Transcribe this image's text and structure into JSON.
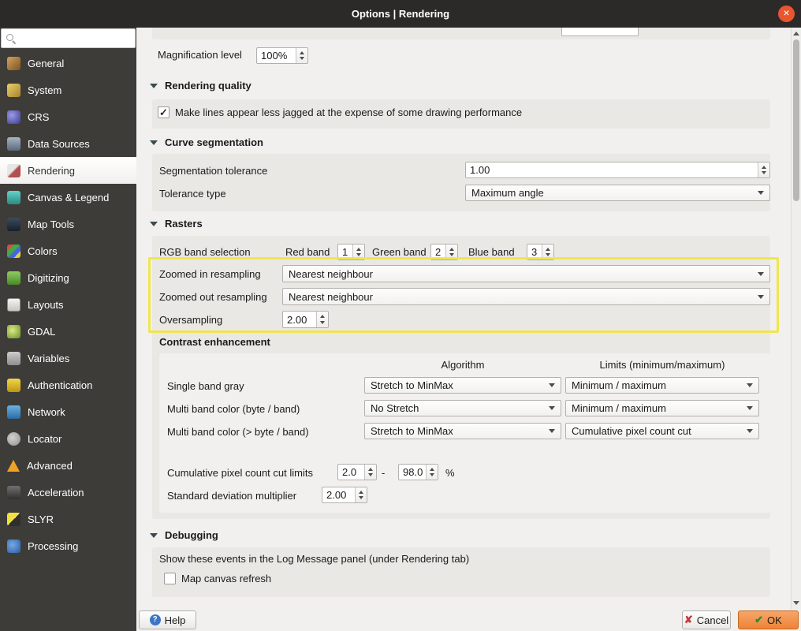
{
  "window": {
    "title": "Options | Rendering",
    "close_glyph": "×"
  },
  "sidebar": {
    "items": [
      {
        "label": "General",
        "icon": "general-icon"
      },
      {
        "label": "System",
        "icon": "system-icon"
      },
      {
        "label": "CRS",
        "icon": "crs-icon"
      },
      {
        "label": "Data Sources",
        "icon": "data-sources-icon"
      },
      {
        "label": "Rendering",
        "icon": "rendering-icon",
        "selected": true
      },
      {
        "label": "Canvas & Legend",
        "icon": "canvas-legend-icon"
      },
      {
        "label": "Map Tools",
        "icon": "map-tools-icon"
      },
      {
        "label": "Colors",
        "icon": "colors-icon"
      },
      {
        "label": "Digitizing",
        "icon": "digitizing-icon"
      },
      {
        "label": "Layouts",
        "icon": "layouts-icon"
      },
      {
        "label": "GDAL",
        "icon": "gdal-icon"
      },
      {
        "label": "Variables",
        "icon": "variables-icon"
      },
      {
        "label": "Authentication",
        "icon": "authentication-icon"
      },
      {
        "label": "Network",
        "icon": "network-icon"
      },
      {
        "label": "Locator",
        "icon": "locator-icon"
      },
      {
        "label": "Advanced",
        "icon": "advanced-icon"
      },
      {
        "label": "Acceleration",
        "icon": "acceleration-icon"
      },
      {
        "label": "SLYR",
        "icon": "slyr-icon"
      },
      {
        "label": "Processing",
        "icon": "processing-icon"
      }
    ]
  },
  "content": {
    "magnification_label": "Magnification level",
    "magnification_value": "100%",
    "check_glyph": "✓",
    "rendering_quality": {
      "title": "Rendering quality",
      "antialias_label": "Make lines appear less jagged at the expense of some drawing performance",
      "antialias_checked": true
    },
    "curve_segmentation": {
      "title": "Curve segmentation",
      "tolerance_label": "Segmentation tolerance",
      "tolerance_value": "1.00",
      "type_label": "Tolerance type",
      "type_value": "Maximum angle"
    },
    "rasters": {
      "title": "Rasters",
      "rgb_label": "RGB band selection",
      "red_label": "Red band",
      "red_value": "1",
      "green_label": "Green band",
      "green_value": "2",
      "blue_label": "Blue band",
      "blue_value": "3",
      "zoomed_in_label": "Zoomed in resampling",
      "zoomed_in_value": "Nearest neighbour",
      "zoomed_out_label": "Zoomed out resampling",
      "zoomed_out_value": "Nearest neighbour",
      "oversampling_label": "Oversampling",
      "oversampling_value": "2.00"
    },
    "contrast": {
      "title": "Contrast enhancement",
      "algorithm_header": "Algorithm",
      "limits_header": "Limits (minimum/maximum)",
      "rows": [
        {
          "label": "Single band gray",
          "algorithm": "Stretch to MinMax",
          "limits": "Minimum / maximum"
        },
        {
          "label": "Multi band color (byte / band)",
          "algorithm": "No Stretch",
          "limits": "Minimum / maximum"
        },
        {
          "label": "Multi band color (> byte / band)",
          "algorithm": "Stretch to MinMax",
          "limits": "Cumulative pixel count cut"
        }
      ],
      "cumulative_label": "Cumulative pixel count cut limits",
      "cumulative_min": "2.0",
      "cumulative_sep": "-",
      "cumulative_max": "98.0",
      "cumulative_unit": "%",
      "stddev_label": "Standard deviation multiplier",
      "stddev_value": "2.00"
    },
    "debugging": {
      "title": "Debugging",
      "description": "Show these events in the Log Message panel (under Rendering tab)",
      "map_canvas_refresh_label": "Map canvas refresh",
      "map_canvas_refresh_checked": false
    }
  },
  "footer": {
    "help_label": "Help",
    "help_icon_glyph": "?",
    "cancel_label": "Cancel",
    "cancel_icon_glyph": "✘",
    "ok_label": "OK",
    "ok_icon_glyph": "✔"
  },
  "colors": {
    "accent_orange": "#e9552e",
    "highlight_yellow": "#f1e64b",
    "titlebar": "#2b2a28",
    "sidebar": "#3e3c39"
  }
}
